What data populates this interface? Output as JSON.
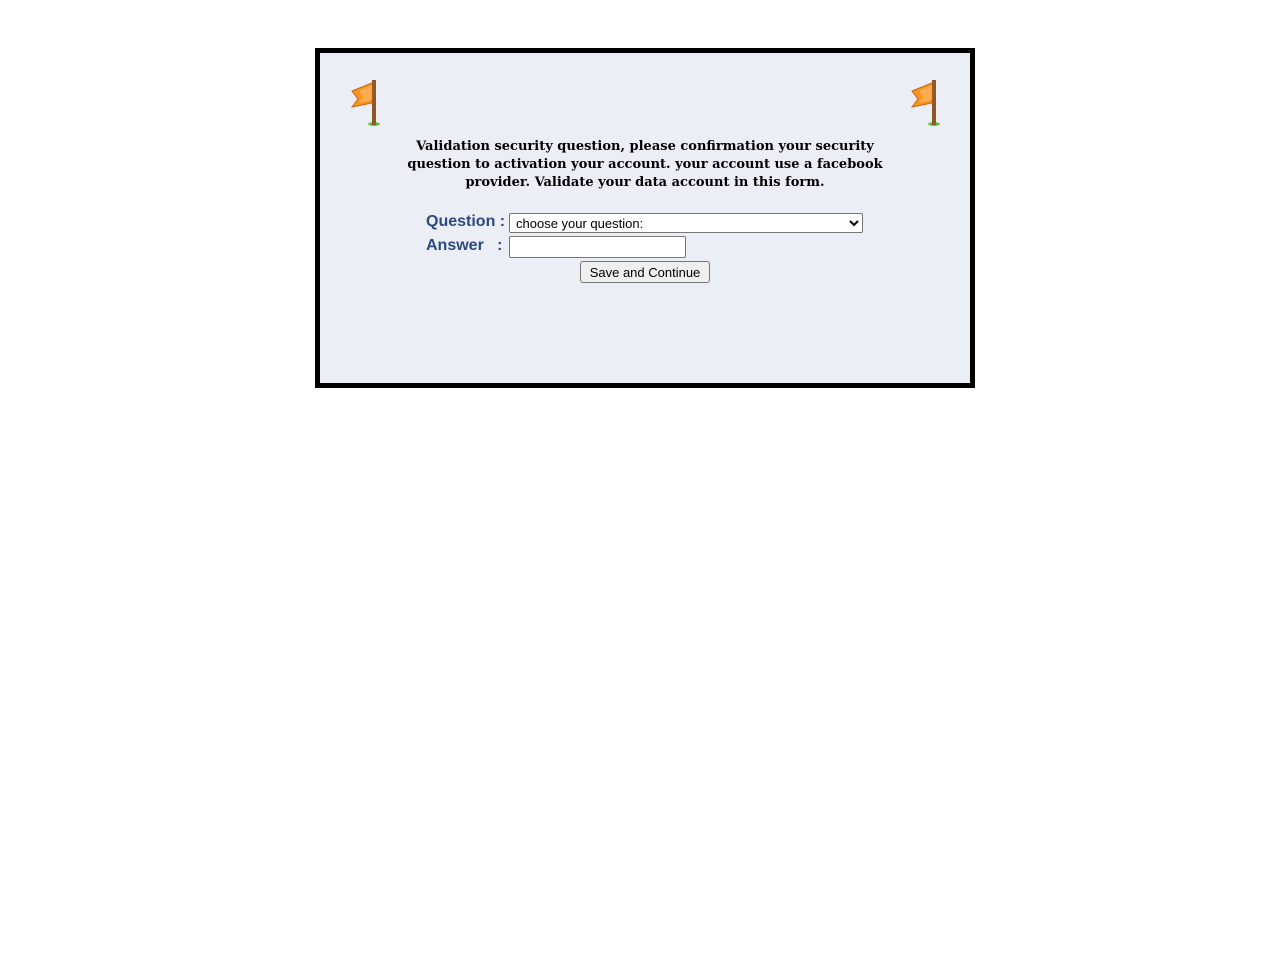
{
  "message": "Validation security question, please confirmation your security question to activation your account. your account use a facebook provider. Validate your data account in this form.",
  "form": {
    "question_label": "Question :",
    "answer_label": "Answer   :",
    "question_selected": "choose your question:",
    "answer_value": "",
    "submit_label": "Save and Continue"
  },
  "colors": {
    "panel_background": "#ebeef5",
    "panel_border": "#000000",
    "label_color": "#2c4a7d",
    "flag_orange": "#f7941d"
  },
  "icons": {
    "left": "orange-flag-icon",
    "right": "orange-flag-icon"
  }
}
